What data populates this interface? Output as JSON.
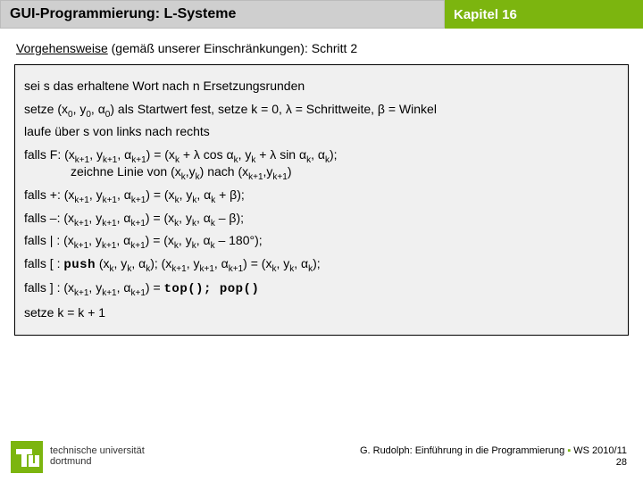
{
  "header": {
    "title": "GUI-Programmierung: L-Systeme",
    "chapter": "Kapitel 16"
  },
  "subtitle": {
    "underlined": "Vorgehensweise",
    "rest": " (gemäß unserer Einschränkungen): Schritt 2"
  },
  "algo": {
    "l1": "sei s das erhaltene Wort nach n Ersetzungsrunden",
    "l2a": "setze (x",
    "l2b": ", y",
    "l2c": ", α",
    "l2d": ") als Startwert fest, setze k = 0, λ = Schrittweite, β = Winkel",
    "l3": "laufe über s von links nach rechts",
    "l4a": "falls F: (x",
    "l4b": ", y",
    "l4c": ", α",
    "l4d": ") = (x",
    "l4e": " + λ cos α",
    "l4f": ", y",
    "l4g": " + λ sin α",
    "l4h": ", α",
    "l4i": ");",
    "l4line2a": "zeichne Linie von (x",
    "l4line2b": ",y",
    "l4line2c": ") nach (x",
    "l4line2d": ",y",
    "l4line2e": ")",
    "l5a": "falls +: (x",
    "l5b": ", y",
    "l5c": ", α",
    "l5d": ") = (x",
    "l5e": ", y",
    "l5f": ", α",
    "l5g": " + β);",
    "l6a": "falls –: (x",
    "l6b": ", y",
    "l6c": ", α",
    "l6d": ") = (x",
    "l6e": ", y",
    "l6f": ", α",
    "l6g": " – β);",
    "l7a": "falls | : (x",
    "l7b": ", y",
    "l7c": ", α",
    "l7d": ") = (x",
    "l7e": ", y",
    "l7f": ", α",
    "l7g": " – 180°);",
    "l8a": "falls [ : ",
    "l8push": "push",
    "l8b": " (x",
    "l8c": ", y",
    "l8d": ", α",
    "l8e": "); (x",
    "l8f": ", y",
    "l8g": ", α",
    "l8h": ") = (x",
    "l8i": ", y",
    "l8j": ", α",
    "l8k": ");",
    "l9a": "falls ] : (x",
    "l9b": ", y",
    "l9c": ", α",
    "l9d": ") = ",
    "l9top": "top();",
    "l9pop": " pop()",
    "l10": "setze k = k + 1",
    "sub0": "0",
    "subk": "k",
    "subk1": "k+1"
  },
  "footer": {
    "line": "G. Rudolph: Einführung in die Programmierung ",
    "sem": " WS 2010/11",
    "page": "28"
  },
  "logo": {
    "line1": "technische universität",
    "line2": "dortmund"
  }
}
